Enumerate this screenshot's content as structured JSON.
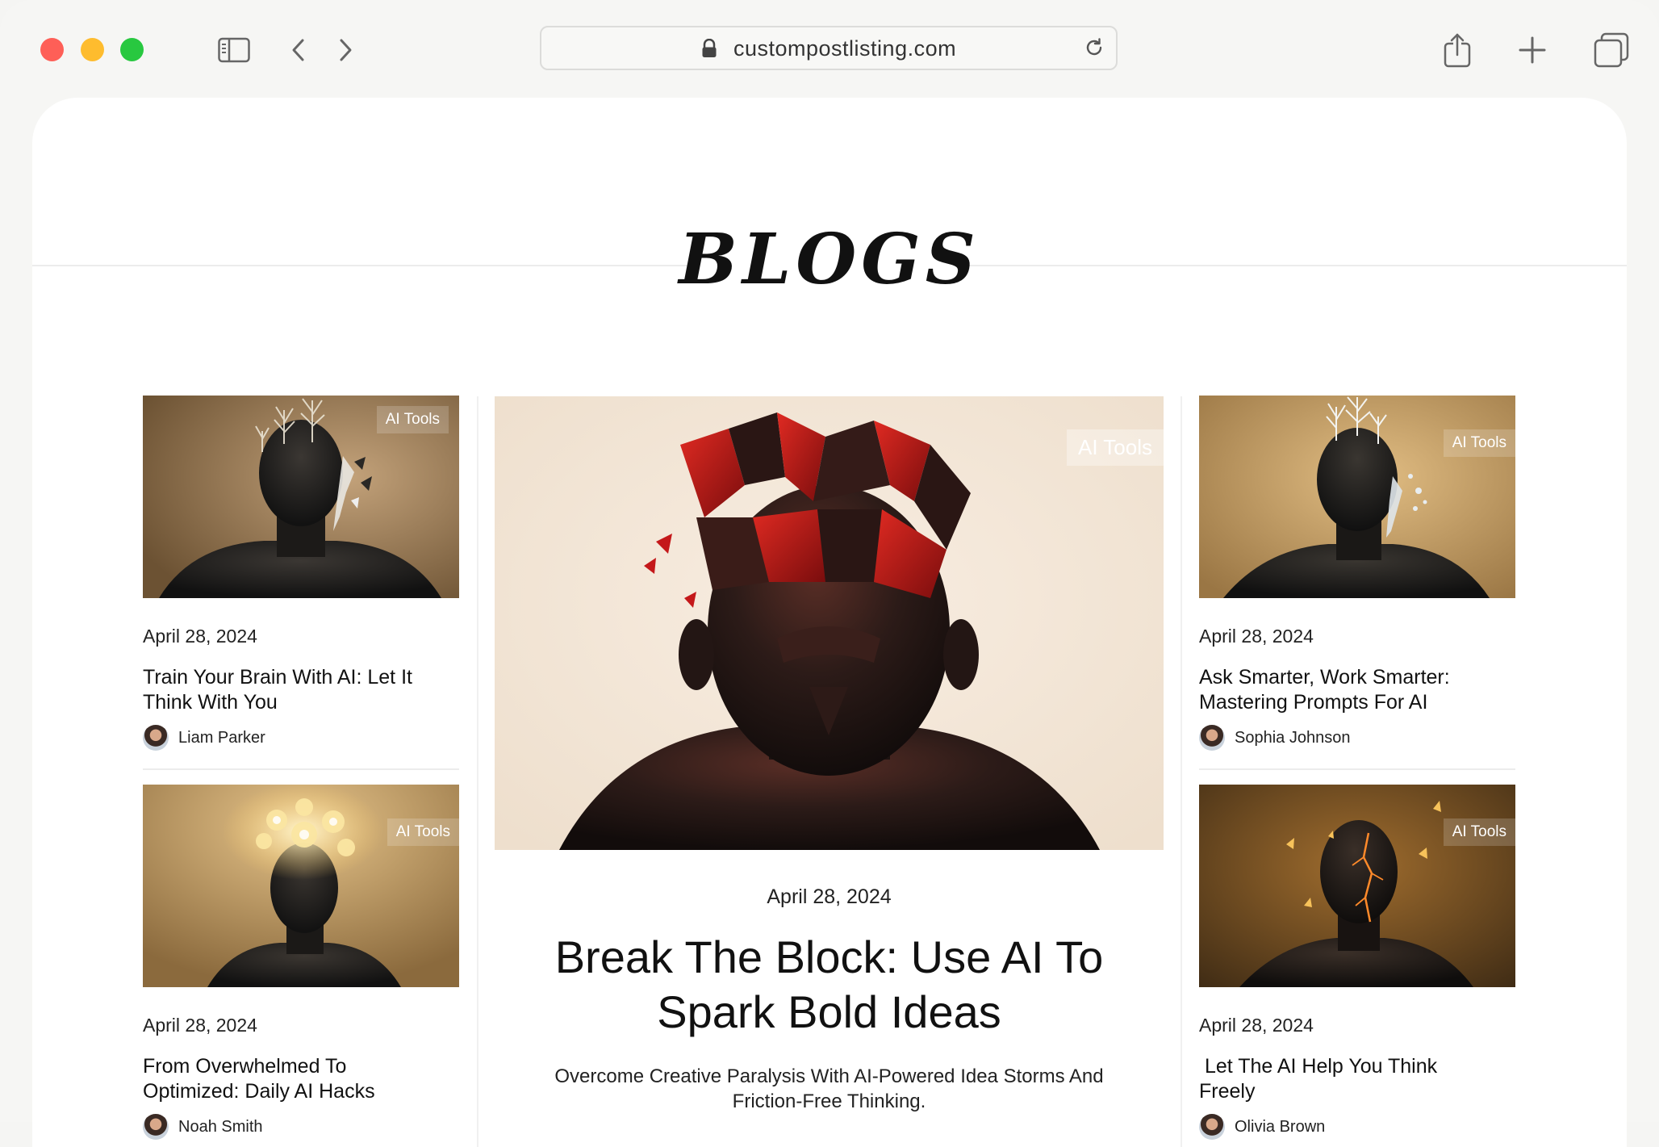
{
  "browser": {
    "url": "custompostlisting.com",
    "icons": [
      "sidebar-icon",
      "back-icon",
      "forward-icon",
      "lock-icon",
      "reload-icon",
      "share-icon",
      "new-tab-icon",
      "tabs-overview-icon"
    ]
  },
  "page": {
    "title": "BLOGS"
  },
  "featured": {
    "tag": "AI Tools",
    "date": "April 28, 2024",
    "title": "Break The Block: Use AI To Spark Bold Ideas",
    "subtitle": "Overcome Creative Paralysis With AI-Powered Idea Storms And Friction-Free Thinking."
  },
  "left_cards": [
    {
      "tag": "AI Tools",
      "date": "April 28, 2024",
      "title": "Train Your Brain With AI: Let It Think With You",
      "author": "Liam Parker"
    },
    {
      "tag": "AI Tools",
      "date": "April 28, 2024",
      "title": "From Overwhelmed To Optimized: Daily AI Hacks",
      "author": "Noah Smith"
    }
  ],
  "right_cards": [
    {
      "tag": "AI Tools",
      "date": "April 28, 2024",
      "title": "Ask Smarter, Work Smarter: Mastering Prompts For AI",
      "author": "Sophia Johnson"
    },
    {
      "tag": "AI Tools",
      "date": "April 28, 2024",
      "title": " Let The AI Help You Think Freely",
      "author": "Olivia Brown"
    }
  ],
  "colors": {
    "window_bg": "#f6f6f4",
    "page_bg": "#ffffff",
    "accent_red": "#b0151a"
  }
}
